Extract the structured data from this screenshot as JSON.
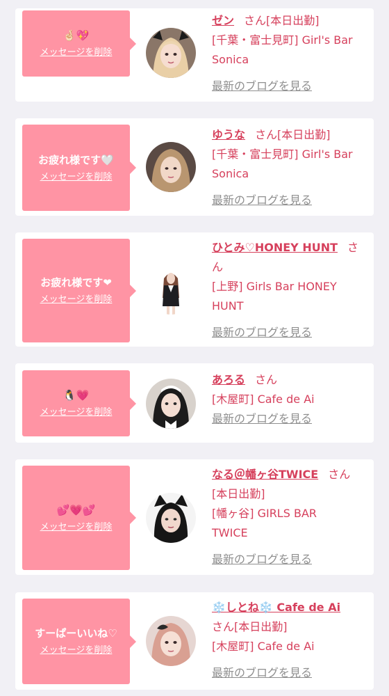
{
  "colors": {
    "page_background": "#f1f0f5",
    "card": "#ffffff",
    "bubble": "#ff94a4",
    "accent_text": "#d6405c",
    "link_gray": "#8f8f8f"
  },
  "delete_label": "メッセージを削除",
  "blog_label": "最新のブログを見る",
  "san_label": "さん",
  "messages": [
    {
      "bubble_text": "🤞🏻💖",
      "name": "ゼン",
      "status": "[本日出勤]",
      "shop_line1": "[千葉・富士見町] Girl's Bar",
      "shop_line2": "Sonica",
      "avatar_icon": "girl-with-cat-ears-avatar"
    },
    {
      "bubble_text": "お疲れ様です🤍",
      "name": "ゆうな",
      "status": "[本日出勤]",
      "shop_line1": "[千葉・富士見町] Girl's Bar",
      "shop_line2": "Sonica",
      "avatar_icon": "girl-blonde-avatar"
    },
    {
      "bubble_text": "お疲れ様です❤",
      "name": "ひとみ♡HONEY HUNT",
      "status": "",
      "shop_line1": "[上野] Girls Bar HONEY",
      "shop_line2": "HUNT",
      "avatar_icon": "girl-full-body-avatar"
    },
    {
      "bubble_text": "🐧💗",
      "name": "あろる",
      "status": "",
      "shop_line1": "[木屋町] Cafe de Ai",
      "shop_line2": "",
      "avatar_icon": "girl-maid-avatar"
    },
    {
      "bubble_text": "💕💗💕",
      "name": "なる＠幡ヶ谷TWICE",
      "status": "[本日出勤]",
      "shop_line1": "[幡ヶ谷] GIRLS BAR",
      "shop_line2": "TWICE",
      "avatar_icon": "girl-black-cat-ears-avatar"
    },
    {
      "bubble_text": "すーぱーいいね♡",
      "name": "❄️しとね❄️ Cafe de Ai",
      "status": "[本日出勤]",
      "shop_line1": "[木屋町] Cafe de Ai",
      "shop_line2": "",
      "avatar_icon": "girl-pink-hair-avatar"
    }
  ]
}
